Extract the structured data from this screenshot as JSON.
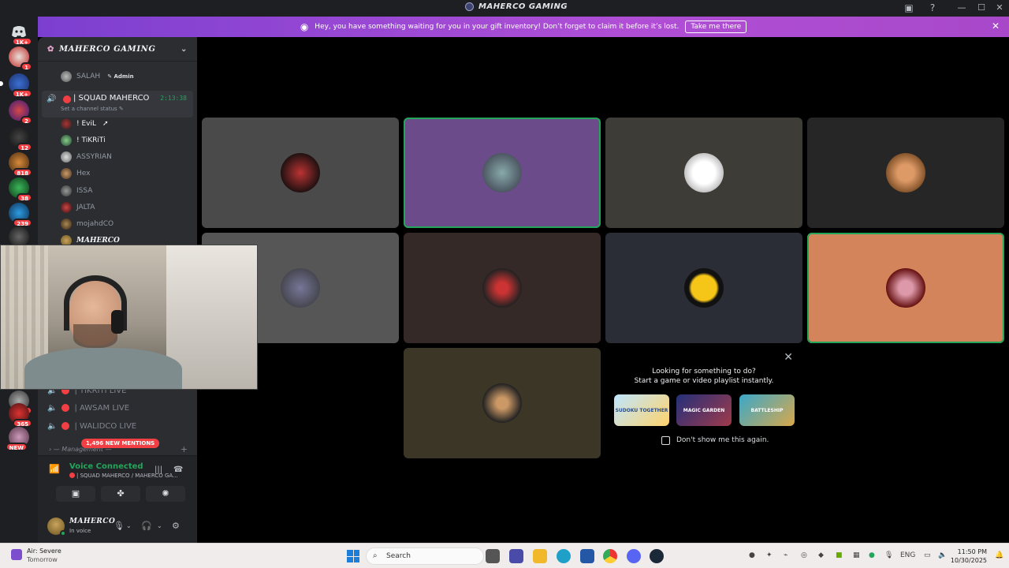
{
  "window": {
    "title": "MAHERCO GAMING"
  },
  "rail": {
    "servers": [
      {
        "badge": "1K+"
      },
      {
        "badge": "1"
      },
      {
        "badge": "1K+"
      },
      {
        "badge": "2"
      },
      {
        "badge": "12"
      },
      {
        "badge": "818"
      },
      {
        "badge": "38"
      },
      {
        "badge": "239"
      },
      {
        "badge": ""
      }
    ],
    "lower_badges": [
      "721",
      "365",
      "NEW"
    ]
  },
  "banner": {
    "text": "Hey, you have something waiting for you in your gift inventory! Don’t forget to claim it before it’s lost.",
    "button": "Take me there"
  },
  "server_header": {
    "name": "MAHERCO GAMING"
  },
  "channel_list": {
    "top_member": {
      "name": "SALAH",
      "tag": "Admin"
    },
    "active_channel": {
      "name": "| SQUAD MAHERCO",
      "timer": "2:13:38",
      "status": "Set a channel status"
    },
    "members": [
      "! EviL",
      "! TiKRiTi",
      "ASSYRIAN",
      "Hex",
      "ISSA",
      "JALTA",
      "mojahdCO",
      "MAHERCO"
    ],
    "voice_channels": [
      "| TIKRITI LIVE",
      "| AWSAM LIVE",
      "| WALIDCO LIVE"
    ],
    "mentions": "1,496 NEW MENTIONS",
    "category": "Management"
  },
  "voice_panel": {
    "title": "Voice Connected",
    "subtitle": "| SQUAD MAHERCO / MAHERCO GA..."
  },
  "user": {
    "name": "MAHERCO",
    "status": "In voice"
  },
  "stage": {
    "tiles": [
      {
        "name": "tile-1",
        "bg": "#4a4a4a"
      },
      {
        "name": "tile-2",
        "bg": "#6c4b8a"
      },
      {
        "name": "tile-3",
        "bg": "#3e3c36"
      },
      {
        "name": "tile-4",
        "bg": "#262626"
      },
      {
        "name": "tile-5",
        "bg": "#565656"
      },
      {
        "name": "tile-6",
        "bg": "#352927"
      },
      {
        "name": "tile-7",
        "bg": "#2a2d36"
      },
      {
        "name": "tile-8",
        "bg": "#d4845b"
      },
      {
        "name": "tile-9",
        "bg": "#3c3626"
      }
    ],
    "promo": {
      "line1": "Looking for something to do?",
      "line2": "Start a game or video playlist instantly.",
      "games": [
        "SUDOKU TOGETHER",
        "MAGIC GARDEN",
        "BATTLESHIP"
      ],
      "checkbox_label": "Don't show me this again."
    }
  },
  "taskbar": {
    "weather_title": "Air: Severe",
    "weather_sub": "Tomorrow",
    "search_placeholder": "Search",
    "lang": "ENG",
    "time": "11:50 PM",
    "date": "10/30/2025"
  },
  "colors": {
    "accent_green": "#23a55a",
    "alert_red": "#f23f43",
    "banner_purple": "#9b47d3"
  }
}
